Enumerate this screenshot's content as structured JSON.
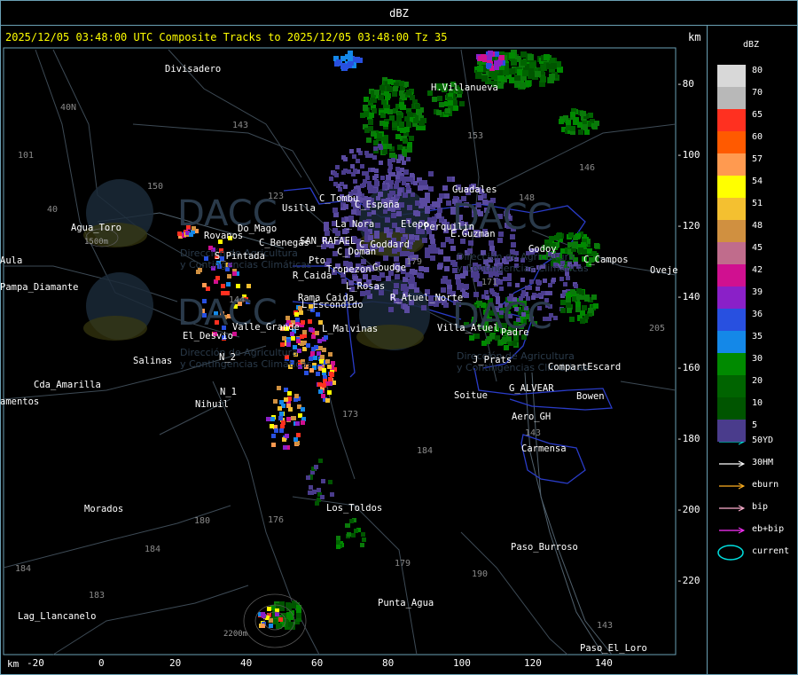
{
  "window": {
    "title": "dBZ"
  },
  "header": {
    "product_line": "2025/12/05 03:48:00 UTC Composite Tracks to 2025/12/05 03:48:00 Tz 35",
    "km_unit_top": "km",
    "km_unit_bottom": "km"
  },
  "axes": {
    "x_ticks": [
      "-20",
      "0",
      "20",
      "40",
      "60",
      "80",
      "100",
      "120",
      "140"
    ],
    "y_ticks": [
      "-80",
      "-100",
      "-120",
      "-140",
      "-160",
      "-180",
      "-200",
      "-220"
    ]
  },
  "legend": {
    "title": "dBZ",
    "scale": [
      {
        "value": "80",
        "color": "#d8d8d8"
      },
      {
        "value": "70",
        "color": "#b8b8b8"
      },
      {
        "value": "65",
        "color": "#ff3020"
      },
      {
        "value": "60",
        "color": "#ff5a00"
      },
      {
        "value": "57",
        "color": "#ff9a50"
      },
      {
        "value": "54",
        "color": "#ffff00"
      },
      {
        "value": "51",
        "color": "#f4c030"
      },
      {
        "value": "48",
        "color": "#d09040"
      },
      {
        "value": "45",
        "color": "#c06c8c"
      },
      {
        "value": "42",
        "color": "#d01090"
      },
      {
        "value": "39",
        "color": "#8a20c8"
      },
      {
        "value": "36",
        "color": "#2850e0"
      },
      {
        "value": "35",
        "color": "#1488e8"
      },
      {
        "value": "30",
        "color": "#008a00"
      },
      {
        "value": "20",
        "color": "#006400"
      },
      {
        "value": "10",
        "color": "#005500"
      },
      {
        "value": "5",
        "color": "#4a3c8c"
      }
    ],
    "tracks": [
      {
        "label": "50YD",
        "color": "#00e0e0"
      },
      {
        "label": "30HM",
        "color": "#ffffff"
      },
      {
        "label": "eburn",
        "color": "#ffb020"
      },
      {
        "label": "bip",
        "color": "#ffb0d0"
      },
      {
        "label": "eb+bip",
        "color": "#ff30ff"
      },
      {
        "label": "current",
        "color": "#00e0e0"
      }
    ]
  },
  "places": [
    "Divisadero",
    "H.Villanueva",
    "Guadales",
    "C_Tombu",
    "Usilla",
    "La_Nora",
    "C_España",
    "Elepo",
    "Perquilin",
    "E.Guzman",
    "Godoy",
    "C_Campos",
    "Oveje",
    "Agua_Toro",
    "Aula",
    "Pampa_Diamante",
    "Rovanos",
    "S_Pintada",
    "Do_Mago",
    "C_Benegas",
    "SAN_RAFAEL",
    "C_Goddard",
    "C_Doman",
    "Pto",
    "Tropezon",
    "Goudge",
    "R_Caida",
    "L_Rosas",
    "R_Atuel_Norte",
    "Rama_Caida",
    "L_Escondido",
    "Valle_Grande",
    "L_Malvinas",
    "Villa_Atuel",
    "Padre",
    "El_Desvio",
    "Salinas",
    "N_2",
    "Cda_Amarilla",
    "N_1",
    "Nihuil",
    "amentos",
    "J_Prats",
    "CompartEscard",
    "G_ALVEAR",
    "Soitue",
    "Bowen",
    "Aero_GH",
    "Carmensa",
    "Los_Toldos",
    "Morados",
    "Paso_Burroso",
    "Punta_Agua",
    "Lag_Llancanelo",
    "Paso_El_Loro",
    "2200m",
    "1500m"
  ],
  "routes": [
    "143",
    "153",
    "146",
    "148",
    "150",
    "101",
    "40N",
    "40",
    "171",
    "173",
    "180",
    "179",
    "184",
    "176",
    "190",
    "143",
    "205",
    "144",
    "123",
    "184",
    "183",
    "184",
    "179",
    "143"
  ],
  "watermark": {
    "brand": "DACC",
    "line1": "Dirección de Agricultura",
    "line2": "y Contingencias Climáticas"
  }
}
